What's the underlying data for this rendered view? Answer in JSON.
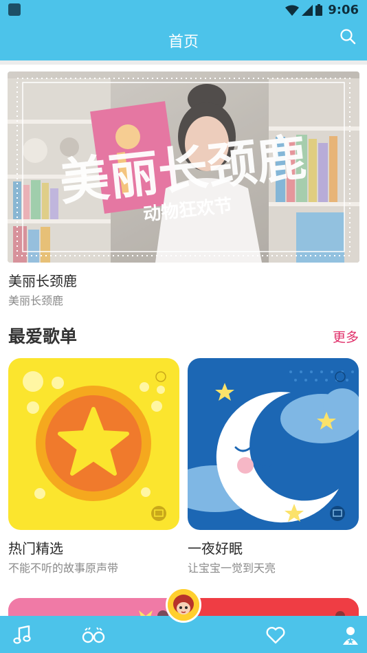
{
  "status_bar": {
    "time": "9:06"
  },
  "header": {
    "title": "首页",
    "search_icon": "search-icon"
  },
  "banner": {
    "overlay_text": "美丽长颈鹿",
    "overlay_sub": "动物狂欢节",
    "title": "美丽长颈鹿",
    "subtitle": "美丽长颈鹿"
  },
  "playlists": {
    "title": "最爱歌单",
    "more": "更多",
    "items": [
      {
        "title": "热门精选",
        "subtitle": "不能不听的故事原声带"
      },
      {
        "title": "一夜好眠",
        "subtitle": "让宝宝一觉到天亮"
      }
    ]
  },
  "bottom_nav": {
    "items": [
      {
        "icon": "music-note-icon"
      },
      {
        "icon": "glasses-icon"
      },
      {
        "icon": "avatar-icon"
      },
      {
        "icon": "heart-icon"
      },
      {
        "icon": "user-icon"
      }
    ]
  },
  "colors": {
    "primary": "#4cc3ea",
    "accent": "#e0306a",
    "text_dark": "#2a2a2a",
    "text_muted": "#8a8a8a"
  }
}
